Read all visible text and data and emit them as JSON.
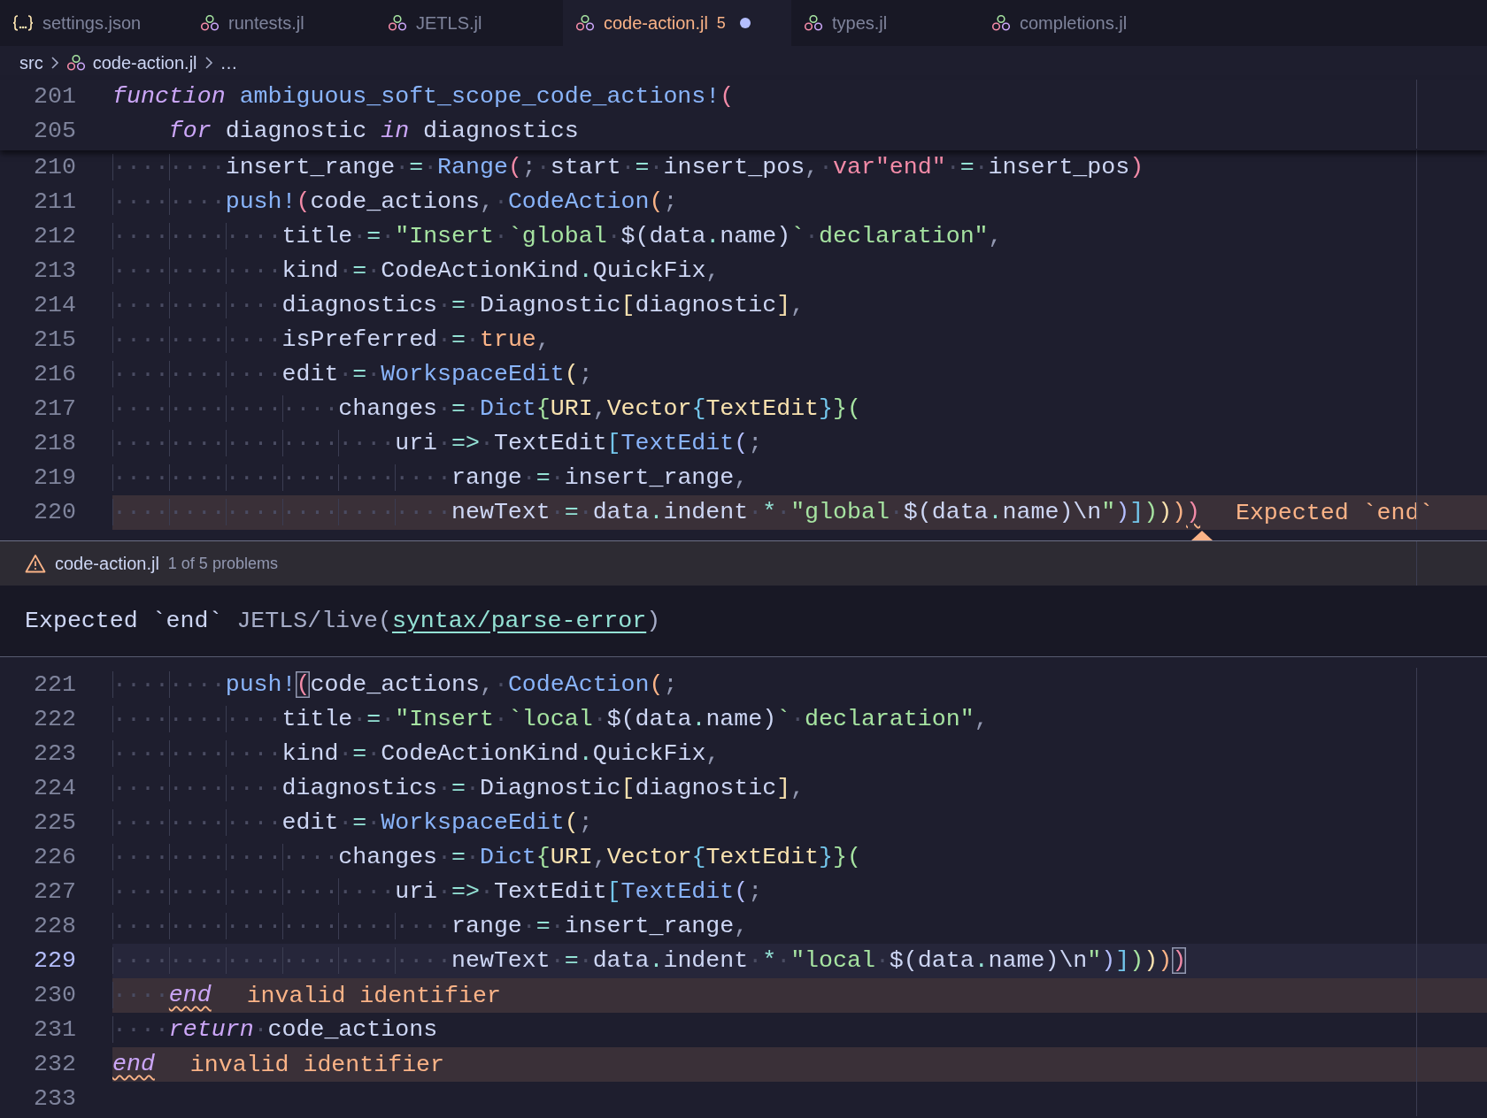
{
  "tabs": [
    {
      "kind": "json",
      "label": "settings.json",
      "selected": false
    },
    {
      "kind": "julia",
      "label": "runtests.jl",
      "selected": false
    },
    {
      "kind": "julia",
      "label": "JETLS.jl",
      "selected": false
    },
    {
      "kind": "julia",
      "label": "code-action.jl",
      "selected": true,
      "count": "5",
      "modified": true
    },
    {
      "kind": "julia",
      "label": "types.jl",
      "selected": false
    },
    {
      "kind": "julia",
      "label": "completions.jl",
      "selected": false
    }
  ],
  "breadcrumb": {
    "folder": "src",
    "file": "code-action.jl",
    "more": "…"
  },
  "sticky_lines": [
    {
      "number": "201",
      "tokens": [
        {
          "kind": "kw",
          "text": "function"
        },
        {
          "kind": "fn",
          "text": " ambiguous_soft_scope_code_actions!"
        },
        {
          "kind": "b1",
          "text": "("
        }
      ]
    },
    {
      "number": "205",
      "tokens": [
        {
          "kind": "kw",
          "text": "    for"
        },
        {
          "kind": "id",
          "text": " diagnostic "
        },
        {
          "kind": "kw",
          "text": "in"
        },
        {
          "kind": "id",
          "text": " diagnostics"
        }
      ]
    }
  ],
  "lines": [
    {
      "number": "210",
      "tokens": [
        {
          "kind": "ws",
          "text": "········"
        },
        {
          "kind": "id",
          "text": "insert_range"
        },
        {
          "kind": "op",
          "text": "·=·"
        },
        {
          "kind": "fn",
          "text": "Range"
        },
        {
          "kind": "b1",
          "text": "("
        },
        {
          "kind": "punc",
          "text": ";·"
        },
        {
          "kind": "id",
          "text": "start"
        },
        {
          "kind": "op",
          "text": "·=·"
        },
        {
          "kind": "id",
          "text": "insert_pos"
        },
        {
          "kind": "punc",
          "text": ",·"
        },
        {
          "kind": "macro",
          "text": "var\"end\""
        },
        {
          "kind": "op",
          "text": "·=·"
        },
        {
          "kind": "id",
          "text": "insert_pos"
        },
        {
          "kind": "b1",
          "text": ")"
        }
      ]
    },
    {
      "number": "211",
      "tokens": [
        {
          "kind": "ws",
          "text": "········"
        },
        {
          "kind": "fn",
          "text": "push!"
        },
        {
          "kind": "b1",
          "text": "("
        },
        {
          "kind": "id",
          "text": "code_actions"
        },
        {
          "kind": "punc",
          "text": ",·"
        },
        {
          "kind": "fn",
          "text": "CodeAction"
        },
        {
          "kind": "b2",
          "text": "("
        },
        {
          "kind": "punc",
          "text": ";"
        }
      ]
    },
    {
      "number": "212",
      "tokens": [
        {
          "kind": "ws",
          "text": "············"
        },
        {
          "kind": "id",
          "text": "title"
        },
        {
          "kind": "op",
          "text": "·=·"
        },
        {
          "kind": "str",
          "text": "\"Insert·`global·"
        },
        {
          "kind": "id",
          "text": "$(data"
        },
        {
          "kind": "op",
          "text": "."
        },
        {
          "kind": "id",
          "text": "name)"
        },
        {
          "kind": "str",
          "text": "`·declaration\""
        },
        {
          "kind": "punc",
          "text": ","
        }
      ]
    },
    {
      "number": "213",
      "tokens": [
        {
          "kind": "ws",
          "text": "············"
        },
        {
          "kind": "id",
          "text": "kind"
        },
        {
          "kind": "op",
          "text": "·=·"
        },
        {
          "kind": "id",
          "text": "CodeActionKind"
        },
        {
          "kind": "op",
          "text": "."
        },
        {
          "kind": "id",
          "text": "QuickFix"
        },
        {
          "kind": "punc",
          "text": ","
        }
      ]
    },
    {
      "number": "214",
      "tokens": [
        {
          "kind": "ws",
          "text": "············"
        },
        {
          "kind": "id",
          "text": "diagnostics"
        },
        {
          "kind": "op",
          "text": "·=·"
        },
        {
          "kind": "id",
          "text": "Diagnostic"
        },
        {
          "kind": "b3",
          "text": "["
        },
        {
          "kind": "id",
          "text": "diagnostic"
        },
        {
          "kind": "b3",
          "text": "]"
        },
        {
          "kind": "punc",
          "text": ","
        }
      ]
    },
    {
      "number": "215",
      "tokens": [
        {
          "kind": "ws",
          "text": "············"
        },
        {
          "kind": "id",
          "text": "isPreferred"
        },
        {
          "kind": "op",
          "text": "·=·"
        },
        {
          "kind": "bool",
          "text": "true"
        },
        {
          "kind": "punc",
          "text": ","
        }
      ]
    },
    {
      "number": "216",
      "tokens": [
        {
          "kind": "ws",
          "text": "············"
        },
        {
          "kind": "id",
          "text": "edit"
        },
        {
          "kind": "op",
          "text": "·=·"
        },
        {
          "kind": "fn",
          "text": "WorkspaceEdit"
        },
        {
          "kind": "b3",
          "text": "("
        },
        {
          "kind": "punc",
          "text": ";"
        }
      ]
    },
    {
      "number": "217",
      "tokens": [
        {
          "kind": "ws",
          "text": "················"
        },
        {
          "kind": "id",
          "text": "changes"
        },
        {
          "kind": "op",
          "text": "·=·"
        },
        {
          "kind": "fn",
          "text": "Dict"
        },
        {
          "kind": "b4",
          "text": "{"
        },
        {
          "kind": "type",
          "text": "URI"
        },
        {
          "kind": "punc",
          "text": ","
        },
        {
          "kind": "type",
          "text": "Vector"
        },
        {
          "kind": "b5",
          "text": "{"
        },
        {
          "kind": "type",
          "text": "TextEdit"
        },
        {
          "kind": "b5",
          "text": "}"
        },
        {
          "kind": "b4",
          "text": "}("
        }
      ]
    },
    {
      "number": "218",
      "tokens": [
        {
          "kind": "ws",
          "text": "····················"
        },
        {
          "kind": "id",
          "text": "uri"
        },
        {
          "kind": "op",
          "text": "·=>·"
        },
        {
          "kind": "id",
          "text": "TextEdit"
        },
        {
          "kind": "b5",
          "text": "["
        },
        {
          "kind": "fn",
          "text": "TextEdit"
        },
        {
          "kind": "b6",
          "text": "("
        },
        {
          "kind": "punc",
          "text": ";"
        }
      ]
    },
    {
      "number": "219",
      "tokens": [
        {
          "kind": "ws",
          "text": "························"
        },
        {
          "kind": "id",
          "text": "range"
        },
        {
          "kind": "op",
          "text": "·=·"
        },
        {
          "kind": "id",
          "text": "insert_range"
        },
        {
          "kind": "punc",
          "text": ","
        }
      ]
    },
    {
      "number": "220",
      "error": true,
      "diagnostic": "Expected `end`",
      "tokens": [
        {
          "kind": "ws",
          "text": "························"
        },
        {
          "kind": "id",
          "text": "newText"
        },
        {
          "kind": "op",
          "text": "·=·"
        },
        {
          "kind": "id",
          "text": "data"
        },
        {
          "kind": "op",
          "text": "."
        },
        {
          "kind": "id",
          "text": "indent"
        },
        {
          "kind": "op",
          "text": "·*·"
        },
        {
          "kind": "str",
          "text": "\"global·"
        },
        {
          "kind": "id",
          "text": "$(data"
        },
        {
          "kind": "op",
          "text": "."
        },
        {
          "kind": "id",
          "text": "name)\\n"
        },
        {
          "kind": "str",
          "text": "\""
        },
        {
          "kind": "b6",
          "text": ")"
        },
        {
          "kind": "b5",
          "text": "]"
        },
        {
          "kind": "b4",
          "text": ")"
        },
        {
          "kind": "b3",
          "text": ")"
        },
        {
          "kind": "b2",
          "text": ")"
        },
        {
          "kind": "b1",
          "text": ")",
          "error": true
        }
      ]
    }
  ],
  "peek": {
    "file": "code-action.jl",
    "position": "1 of 5 problems",
    "message": "Expected `end`",
    "source": "JETLS/live(",
    "code": "syntax/parse-error",
    "source_end": ")"
  },
  "lines_after": [
    {
      "number": "221",
      "tokens": [
        {
          "kind": "ws",
          "text": "········"
        },
        {
          "kind": "fn",
          "text": "push!"
        },
        {
          "kind": "b1",
          "text": "(",
          "matched": true
        },
        {
          "kind": "id",
          "text": "code_actions"
        },
        {
          "kind": "punc",
          "text": ",·"
        },
        {
          "kind": "fn",
          "text": "CodeAction"
        },
        {
          "kind": "b2",
          "text": "("
        },
        {
          "kind": "punc",
          "text": ";"
        }
      ]
    },
    {
      "number": "222",
      "tokens": [
        {
          "kind": "ws",
          "text": "············"
        },
        {
          "kind": "id",
          "text": "title"
        },
        {
          "kind": "op",
          "text": "·=·"
        },
        {
          "kind": "str",
          "text": "\"Insert·`local·"
        },
        {
          "kind": "id",
          "text": "$(data"
        },
        {
          "kind": "op",
          "text": "."
        },
        {
          "kind": "id",
          "text": "name)"
        },
        {
          "kind": "str",
          "text": "`·declaration\""
        },
        {
          "kind": "punc",
          "text": ","
        }
      ]
    },
    {
      "number": "223",
      "tokens": [
        {
          "kind": "ws",
          "text": "············"
        },
        {
          "kind": "id",
          "text": "kind"
        },
        {
          "kind": "op",
          "text": "·=·"
        },
        {
          "kind": "id",
          "text": "CodeActionKind"
        },
        {
          "kind": "op",
          "text": "."
        },
        {
          "kind": "id",
          "text": "QuickFix"
        },
        {
          "kind": "punc",
          "text": ","
        }
      ]
    },
    {
      "number": "224",
      "tokens": [
        {
          "kind": "ws",
          "text": "············"
        },
        {
          "kind": "id",
          "text": "diagnostics"
        },
        {
          "kind": "op",
          "text": "·=·"
        },
        {
          "kind": "id",
          "text": "Diagnostic"
        },
        {
          "kind": "b3",
          "text": "["
        },
        {
          "kind": "id",
          "text": "diagnostic"
        },
        {
          "kind": "b3",
          "text": "]"
        },
        {
          "kind": "punc",
          "text": ","
        }
      ]
    },
    {
      "number": "225",
      "tokens": [
        {
          "kind": "ws",
          "text": "············"
        },
        {
          "kind": "id",
          "text": "edit"
        },
        {
          "kind": "op",
          "text": "·=·"
        },
        {
          "kind": "fn",
          "text": "WorkspaceEdit"
        },
        {
          "kind": "b3",
          "text": "("
        },
        {
          "kind": "punc",
          "text": ";"
        }
      ]
    },
    {
      "number": "226",
      "tokens": [
        {
          "kind": "ws",
          "text": "················"
        },
        {
          "kind": "id",
          "text": "changes"
        },
        {
          "kind": "op",
          "text": "·=·"
        },
        {
          "kind": "fn",
          "text": "Dict"
        },
        {
          "kind": "b4",
          "text": "{"
        },
        {
          "kind": "type",
          "text": "URI"
        },
        {
          "kind": "punc",
          "text": ","
        },
        {
          "kind": "type",
          "text": "Vector"
        },
        {
          "kind": "b5",
          "text": "{"
        },
        {
          "kind": "type",
          "text": "TextEdit"
        },
        {
          "kind": "b5",
          "text": "}"
        },
        {
          "kind": "b4",
          "text": "}("
        }
      ]
    },
    {
      "number": "227",
      "tokens": [
        {
          "kind": "ws",
          "text": "····················"
        },
        {
          "kind": "id",
          "text": "uri"
        },
        {
          "kind": "op",
          "text": "·=>·"
        },
        {
          "kind": "id",
          "text": "TextEdit"
        },
        {
          "kind": "b5",
          "text": "["
        },
        {
          "kind": "fn",
          "text": "TextEdit"
        },
        {
          "kind": "b6",
          "text": "("
        },
        {
          "kind": "punc",
          "text": ";"
        }
      ]
    },
    {
      "number": "228",
      "tokens": [
        {
          "kind": "ws",
          "text": "························"
        },
        {
          "kind": "id",
          "text": "range"
        },
        {
          "kind": "op",
          "text": "·=·"
        },
        {
          "kind": "id",
          "text": "insert_range"
        },
        {
          "kind": "punc",
          "text": ","
        }
      ]
    },
    {
      "number": "229",
      "current": true,
      "tokens": [
        {
          "kind": "ws",
          "text": "························"
        },
        {
          "kind": "id",
          "text": "newText"
        },
        {
          "kind": "op",
          "text": "·=·"
        },
        {
          "kind": "id",
          "text": "data"
        },
        {
          "kind": "op",
          "text": "."
        },
        {
          "kind": "id",
          "text": "indent"
        },
        {
          "kind": "op",
          "text": "·*·"
        },
        {
          "kind": "str",
          "text": "\"local·"
        },
        {
          "kind": "id",
          "text": "$(data"
        },
        {
          "kind": "op",
          "text": "."
        },
        {
          "kind": "id",
          "text": "name)\\n"
        },
        {
          "kind": "str",
          "text": "\""
        },
        {
          "kind": "b6",
          "text": ")"
        },
        {
          "kind": "b5",
          "text": "]"
        },
        {
          "kind": "b4",
          "text": ")"
        },
        {
          "kind": "b3",
          "text": ")"
        },
        {
          "kind": "b2",
          "text": ")"
        },
        {
          "kind": "b1",
          "text": ")",
          "matched": true
        }
      ]
    },
    {
      "number": "230",
      "error": true,
      "diagnostic": "invalid identifier",
      "tokens": [
        {
          "kind": "ws",
          "text": "····"
        },
        {
          "kind": "kw",
          "text": "end",
          "error": true
        }
      ]
    },
    {
      "number": "231",
      "tokens": [
        {
          "kind": "ws",
          "text": "····"
        },
        {
          "kind": "kw",
          "text": "return"
        },
        {
          "kind": "id",
          "text": "·code_actions"
        }
      ]
    },
    {
      "number": "232",
      "error": true,
      "diagnostic": "invalid identifier",
      "tokens": [
        {
          "kind": "kw",
          "text": "end",
          "error": true
        }
      ]
    },
    {
      "number": "233"
    }
  ]
}
